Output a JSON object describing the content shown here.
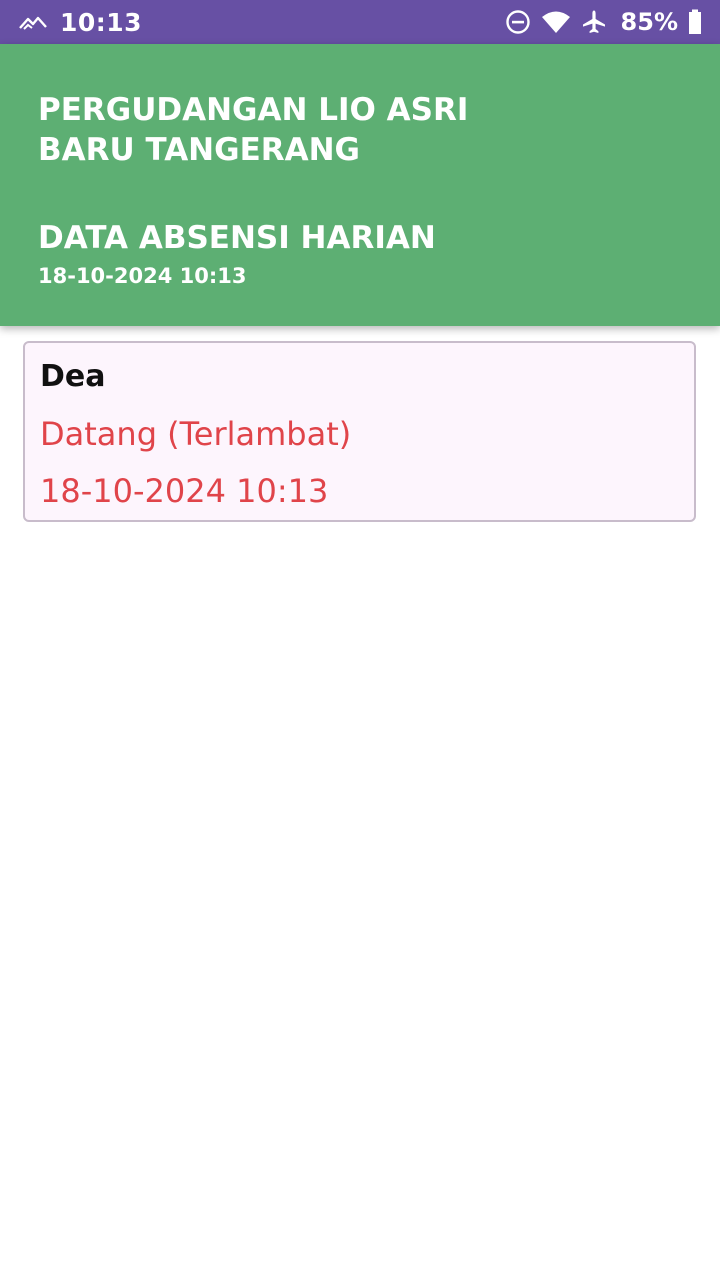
{
  "status_bar": {
    "time": "10:13",
    "battery": "85%",
    "icons": [
      "signal-icon",
      "do-not-disturb-icon",
      "wifi-icon",
      "airplane-icon",
      "battery-icon"
    ]
  },
  "header": {
    "company": "PERGUDANGAN LIO ASRI BARU TANGERANG",
    "section": "DATA ABSENSI HARIAN",
    "datetime": "18-10-2024 10:13"
  },
  "records": [
    {
      "name": "Dea",
      "status": "Datang (Terlambat)",
      "datetime": "18-10-2024 10:13"
    }
  ],
  "colors": {
    "status_bar": "#6750a4",
    "header": "#5daf73",
    "late_text": "#e0444a",
    "card_bg": "#fdf5fd",
    "card_border": "#c8bccb"
  }
}
